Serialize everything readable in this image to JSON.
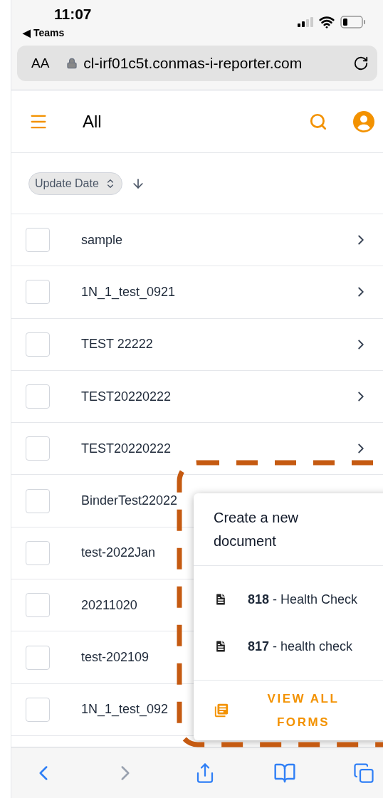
{
  "status_bar": {
    "time": "11:07",
    "back_app": "◀ Teams"
  },
  "address_bar": {
    "text_size": "AA",
    "url": "cl-irf01c5t.conmas-i-reporter.com"
  },
  "header": {
    "title": "All"
  },
  "sort": {
    "label": "Update Date"
  },
  "rows": [
    {
      "name": "sample",
      "checked": false,
      "chevron": true
    },
    {
      "name": "1N_1_test_0921",
      "checked": false,
      "chevron": true
    },
    {
      "name": "TEST 22222",
      "checked": false,
      "chevron": true
    },
    {
      "name": "TEST20220222",
      "checked": false,
      "chevron": true
    },
    {
      "name": "TEST20220222",
      "checked": false,
      "chevron": true
    },
    {
      "name": "BinderTest22022",
      "checked": false
    },
    {
      "name": "test-2022Jan",
      "checked": false
    },
    {
      "name": "20211020",
      "checked": false
    },
    {
      "name": "test-202109",
      "checked": false
    },
    {
      "name": "1N_1_test_092",
      "checked": false
    }
  ],
  "popup": {
    "title": "Create a new document",
    "items": [
      {
        "number": "818",
        "name": " - Health Check"
      },
      {
        "number": "817",
        "name": " - health check"
      }
    ],
    "view_all": "VIEW ALL FORMS"
  }
}
